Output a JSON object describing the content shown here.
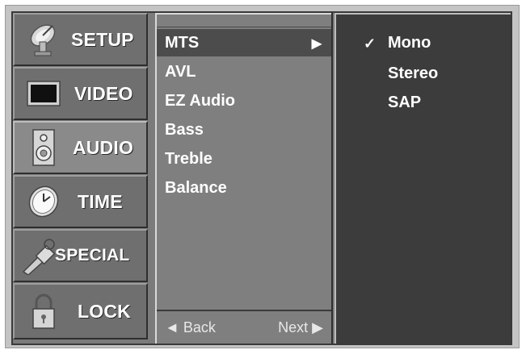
{
  "categories": [
    {
      "label": "SETUP",
      "icon": "satellite-dish-icon"
    },
    {
      "label": "VIDEO",
      "icon": "monitor-icon"
    },
    {
      "label": "AUDIO",
      "icon": "speaker-icon"
    },
    {
      "label": "TIME",
      "icon": "clock-icon"
    },
    {
      "label": "SPECIAL",
      "icon": "key-tag-icon"
    },
    {
      "label": "LOCK",
      "icon": "padlock-icon"
    }
  ],
  "active_category": "AUDIO",
  "submenu": {
    "items": [
      "MTS",
      "AVL",
      "EZ Audio",
      "Bass",
      "Treble",
      "Balance"
    ],
    "selected": "MTS",
    "selected_arrow": "▶",
    "back_label": "◄ Back",
    "next_label": "Next ▶"
  },
  "options": {
    "check_mark": "✓",
    "items": [
      "Mono",
      "Stereo",
      "SAP"
    ],
    "selected": "Mono"
  },
  "colors": {
    "frame": "#c4c4c4",
    "panel": "#7b7b7b",
    "highlight": "#4c4c4c",
    "options_bg": "#3c3c3c",
    "text": "#ffffff"
  }
}
